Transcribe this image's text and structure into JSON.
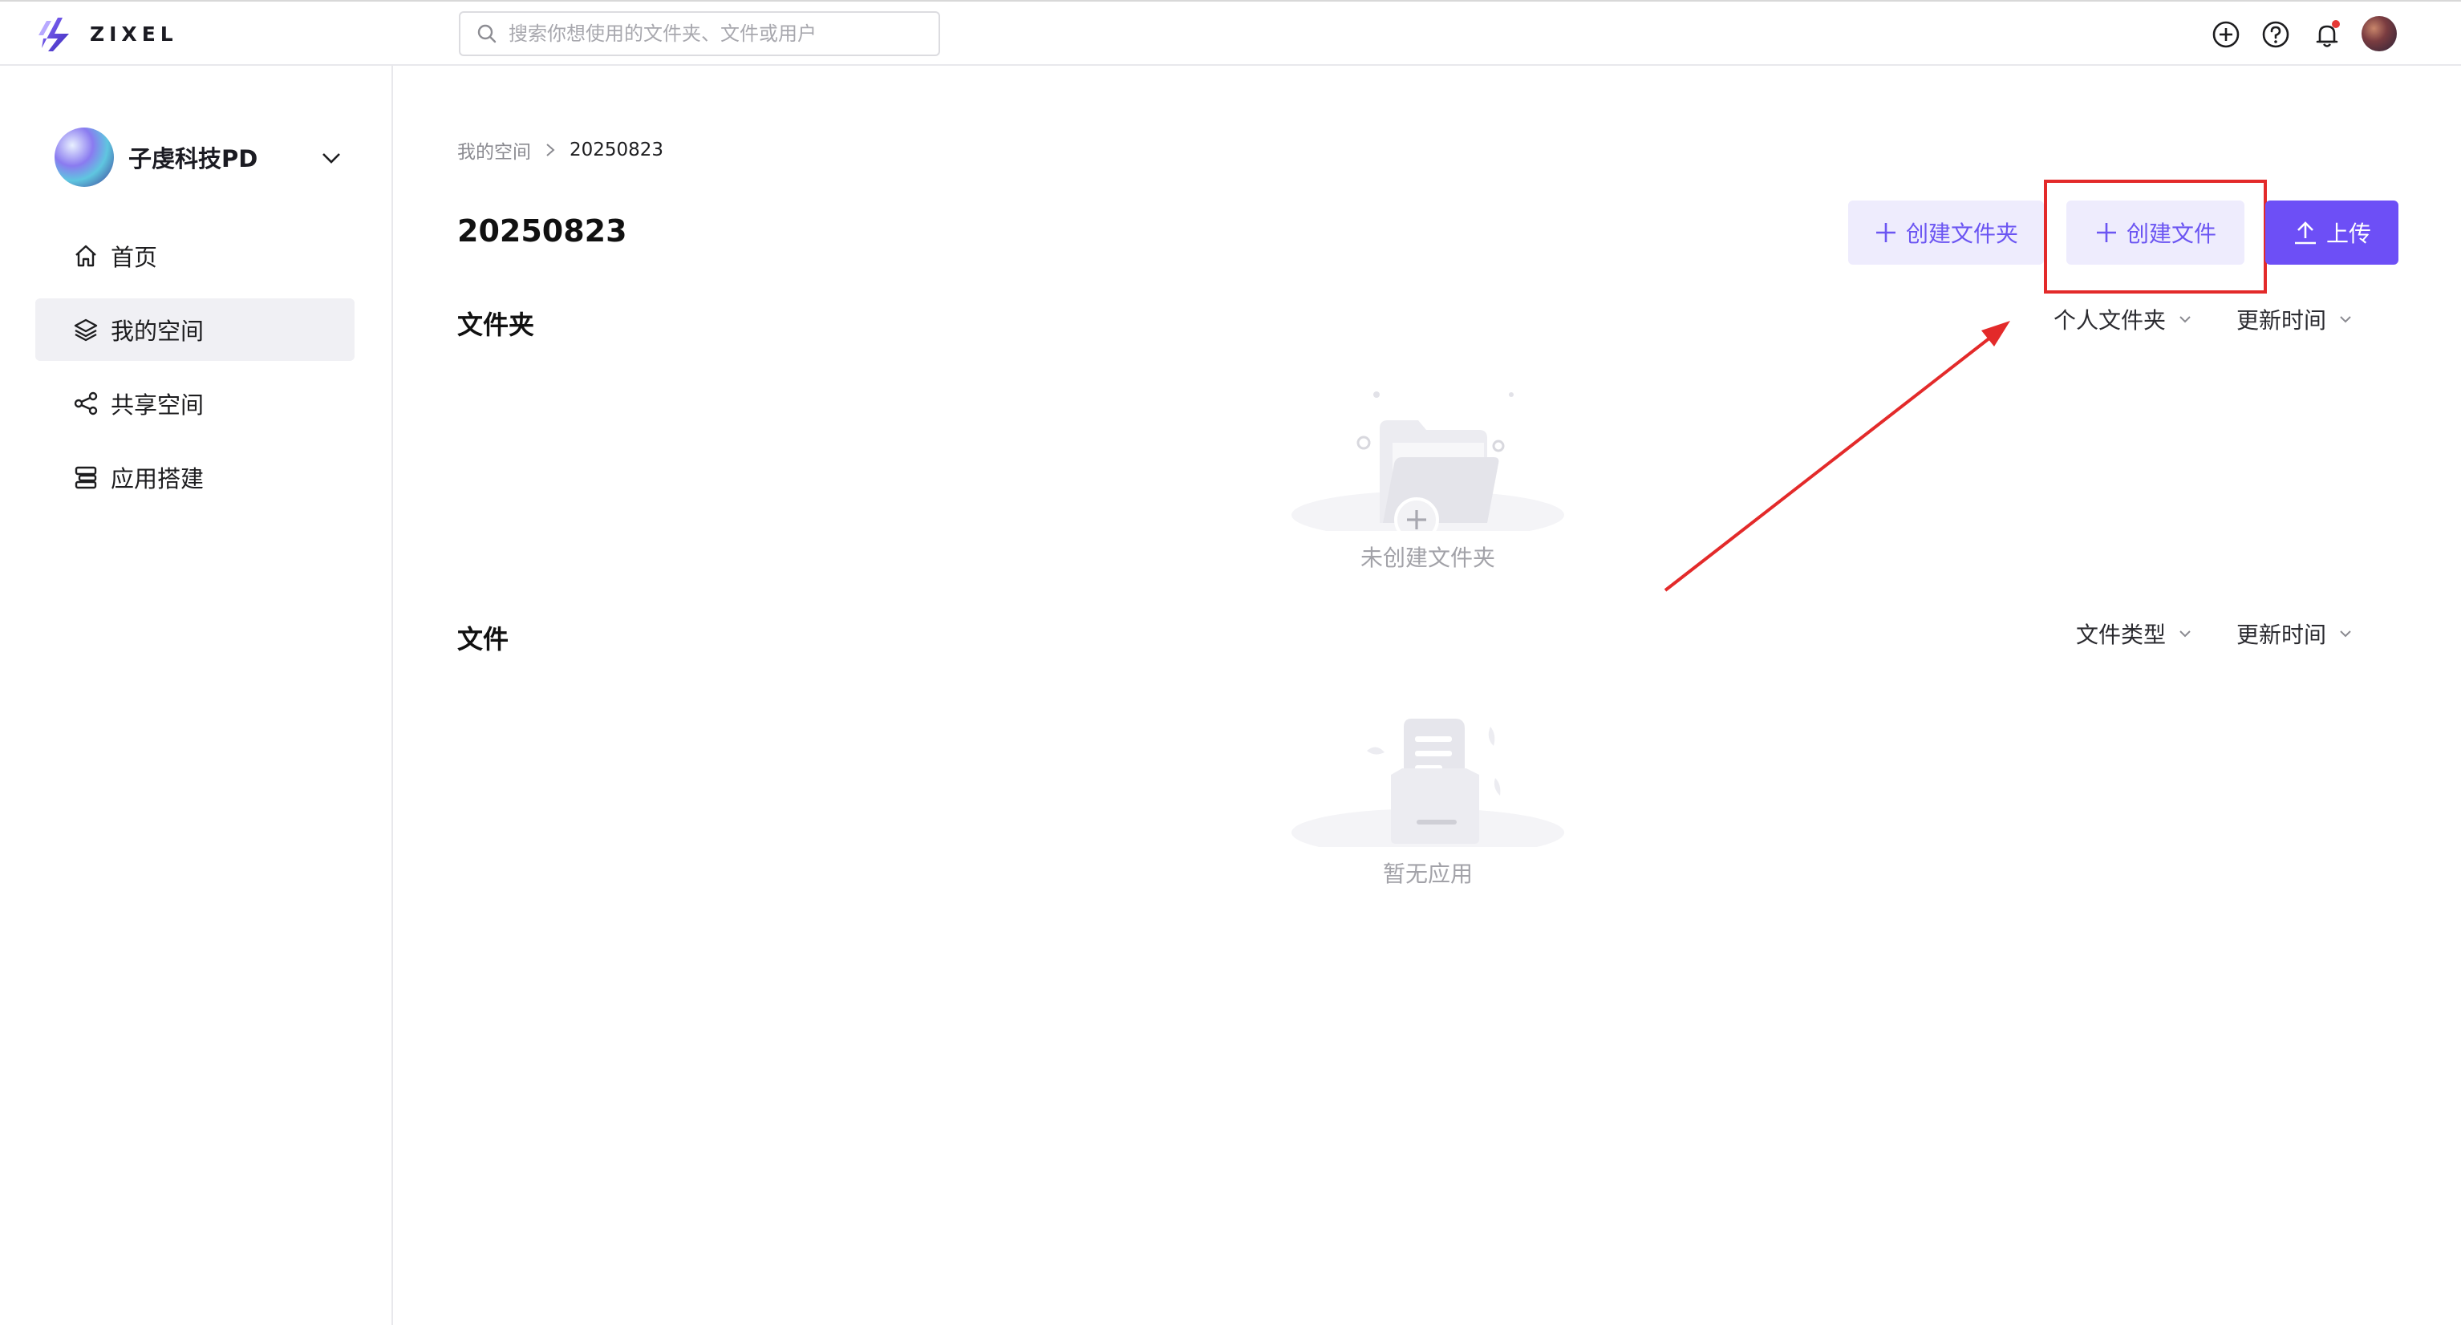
{
  "header": {
    "logo_text": "ZIXEL",
    "search_placeholder": "搜索你想使用的文件夹、文件或用户",
    "icons": [
      "plus-circle-icon",
      "help-icon",
      "bell-icon",
      "avatar"
    ],
    "notification_dot_color": "#e53935"
  },
  "sidebar": {
    "team_name": "子虔科技PD",
    "items": [
      {
        "label": "首页",
        "icon": "home-icon",
        "active": false
      },
      {
        "label": "我的空间",
        "icon": "layers-icon",
        "active": true
      },
      {
        "label": "共享空间",
        "icon": "share-icon",
        "active": false
      },
      {
        "label": "应用搭建",
        "icon": "server-icon",
        "active": false
      }
    ]
  },
  "main": {
    "breadcrumb": [
      "我的空间",
      "20250823"
    ],
    "title": "20250823",
    "buttons": {
      "create_folder": "创建文件夹",
      "create_file": "创建文件",
      "upload": "上传"
    },
    "folders": {
      "title": "文件夹",
      "filters": [
        "个人文件夹",
        "更新时间"
      ],
      "empty_text": "未创建文件夹"
    },
    "files": {
      "title": "文件",
      "filters": [
        "文件类型",
        "更新时间"
      ],
      "empty_text": "暂无应用"
    }
  },
  "colors": {
    "accent": "#6d4ff6",
    "soft_accent_bg": "#eeecfd",
    "annotation_red": "#e32a2a"
  }
}
